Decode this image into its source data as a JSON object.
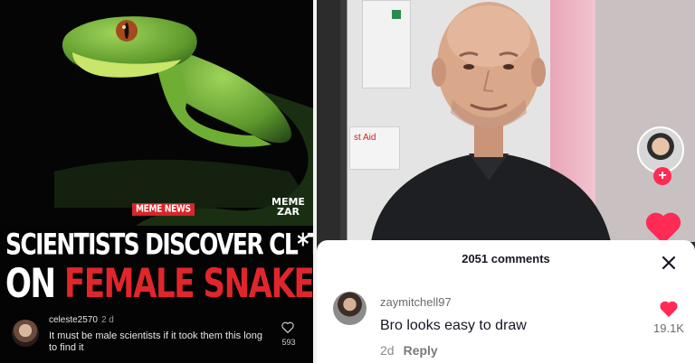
{
  "left_post": {
    "badge": "MEME NEWS",
    "logo_line1": "MEME",
    "logo_line2": "ZAR",
    "headline_line1": "SCIENTISTS DISCOVER CL*TORISES",
    "headline_line2_prefix": "ON",
    "headline_line2_highlight": "FEMALE SNAKES",
    "accent_color": "#e1262b",
    "comment": {
      "username": "celeste2570",
      "time": "2 d",
      "text": "It must be male scientists if it took them this long to find it",
      "likes": "593"
    }
  },
  "right_video": {
    "first_aid_sign": "st Aid",
    "comments_header": "2051 comments",
    "comment": {
      "username": "zaymitchell97",
      "text": "Bro looks easy to draw",
      "time": "2d",
      "reply_label": "Reply",
      "likes": "19.1K"
    },
    "like_color": "#fe2c55"
  }
}
